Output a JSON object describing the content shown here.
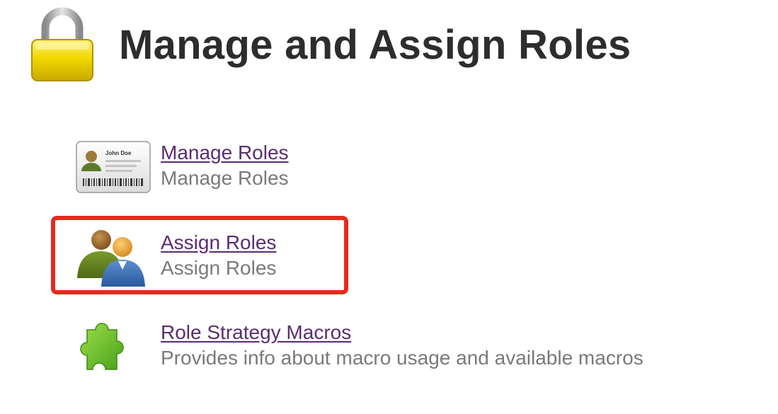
{
  "page": {
    "title": "Manage and Assign Roles",
    "header_icon": "lock-icon"
  },
  "items": [
    {
      "icon": "id-card-icon",
      "link": "Manage Roles",
      "description": "Manage Roles"
    },
    {
      "icon": "users-icon",
      "link": "Assign Roles",
      "description": "Assign Roles",
      "highlighted": true
    },
    {
      "icon": "puzzle-piece-icon",
      "link": "Role Strategy Macros",
      "description": "Provides info about macro usage and available macros"
    }
  ],
  "id_card": {
    "name": "John Doe"
  },
  "colors": {
    "title": "#2d2d2d",
    "link": "#5b2d6f",
    "description": "#7a7a7a",
    "highlight": "#e8291c",
    "lock": "#f0d000",
    "puzzle": "#6cc524"
  }
}
